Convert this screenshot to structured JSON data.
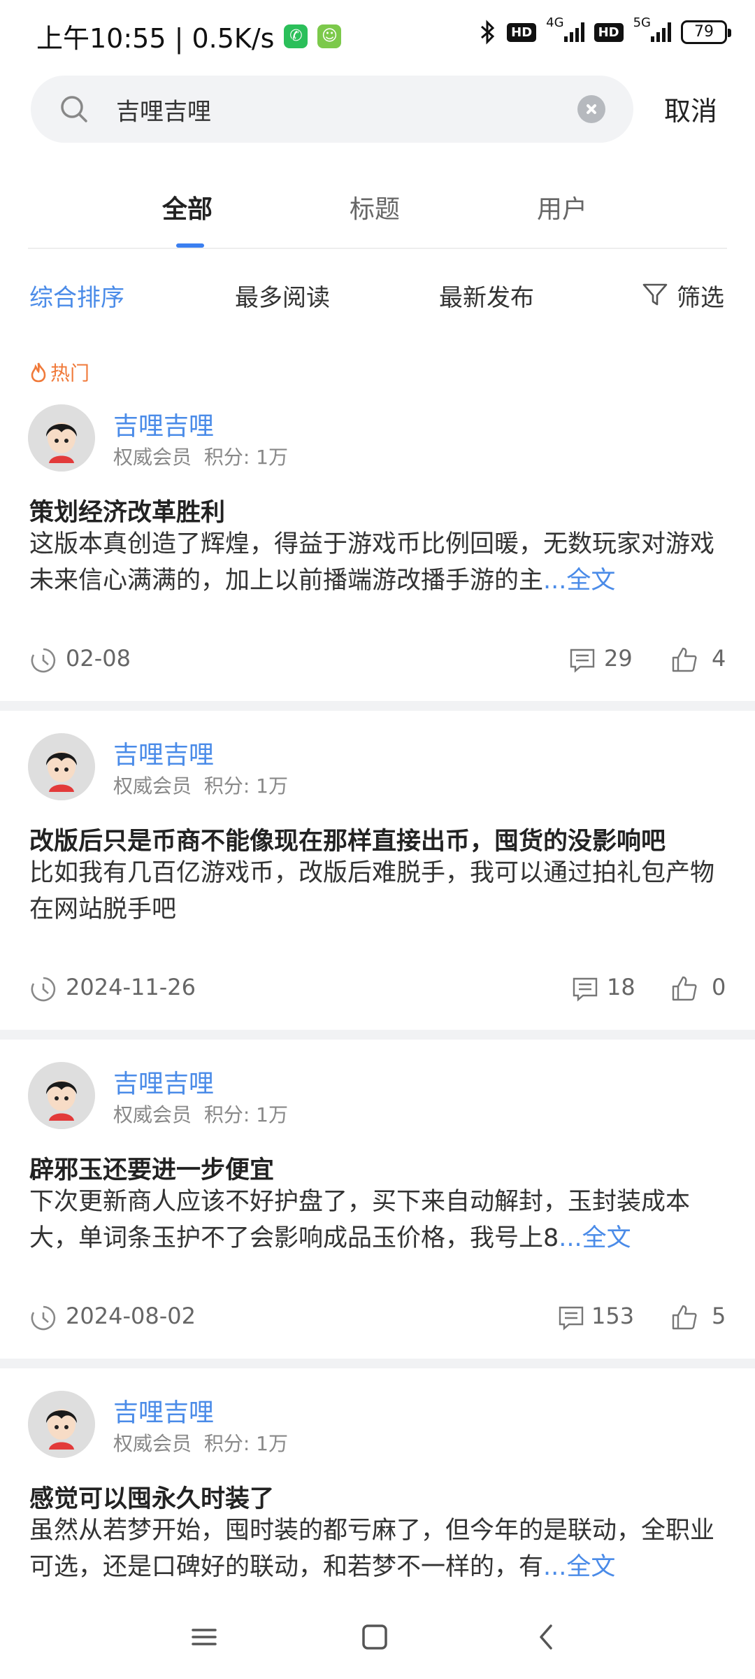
{
  "status_bar": {
    "time_speed": "上午10:55 | 0.5K/s",
    "network_top": "4G",
    "network_second": "5G",
    "hd_label": "HD",
    "battery": "79"
  },
  "search": {
    "query": "吉哩吉哩",
    "cancel_label": "取消"
  },
  "tabs": [
    {
      "label": "全部"
    },
    {
      "label": "标题"
    },
    {
      "label": "用户"
    }
  ],
  "sort": {
    "options": [
      {
        "label": "综合排序"
      },
      {
        "label": "最多阅读"
      },
      {
        "label": "最新发布"
      }
    ],
    "filter_label": "筛选"
  },
  "hot_label": "热门",
  "posts": [
    {
      "author": "吉哩吉哩",
      "role": "权威会员",
      "points": "积分: 1万",
      "title": "策划经济改革胜利",
      "excerpt": "这版本真创造了辉煌，得益于游戏币比例回暖，无数玩家对游戏未来信心满满的，加上以前播端游改播手游的主",
      "more": "...全文",
      "date": "02-08",
      "comments": "29",
      "likes": "4"
    },
    {
      "author": "吉哩吉哩",
      "role": "权威会员",
      "points": "积分: 1万",
      "title": "改版后只是币商不能像现在那样直接出币，囤货的没影响吧",
      "excerpt": "比如我有几百亿游戏币，改版后难脱手，我可以通过拍礼包产物在网站脱手吧",
      "more": "",
      "date": "2024-11-26",
      "comments": "18",
      "likes": "0"
    },
    {
      "author": "吉哩吉哩",
      "role": "权威会员",
      "points": "积分: 1万",
      "title": "辟邪玉还要进一步便宜",
      "excerpt": "下次更新商人应该不好护盘了，买下来自动解封，玉封装成本大，单词条玉护不了会影响成品玉价格，我号上8",
      "more": "...全文",
      "date": "2024-08-02",
      "comments": "153",
      "likes": "5"
    },
    {
      "author": "吉哩吉哩",
      "role": "权威会员",
      "points": "积分: 1万",
      "title": "感觉可以囤永久时装了",
      "excerpt": "虽然从若梦开始，囤时装的都亏麻了，但今年的是联动，全职业可选，还是口碑好的联动，和若梦不一样的，有",
      "more": "...全文"
    }
  ],
  "colors": {
    "accent": "#4a8be8",
    "hot": "#f07a3a",
    "separator": "#f1f2f4"
  }
}
